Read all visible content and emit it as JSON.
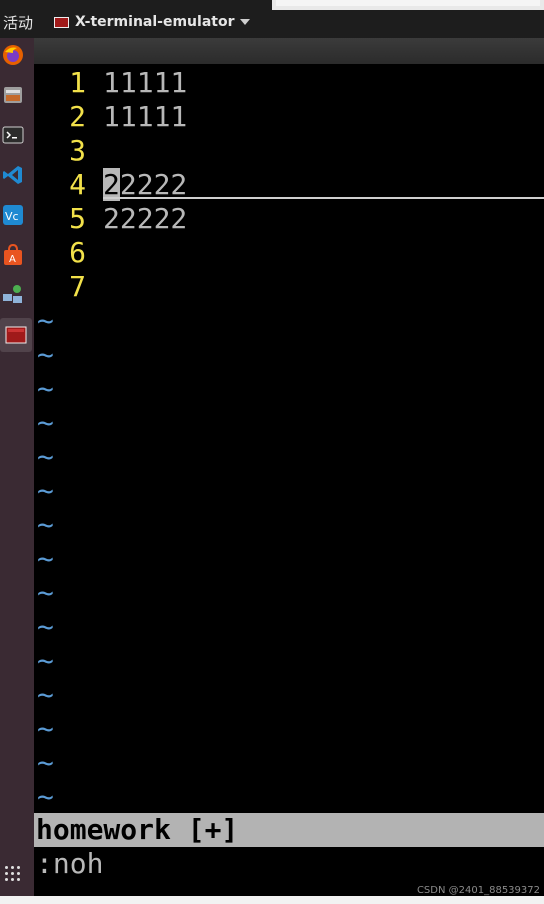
{
  "topbar": {
    "activities": "活动",
    "app_name": "X-terminal-emulator"
  },
  "dock": {
    "items": [
      {
        "name": "firefox-icon"
      },
      {
        "name": "files-icon"
      },
      {
        "name": "terminal-icon"
      },
      {
        "name": "vscode-icon"
      },
      {
        "name": "vnc-icon"
      },
      {
        "name": "software-center-icon"
      },
      {
        "name": "network-icon"
      },
      {
        "name": "x-terminal-icon"
      }
    ]
  },
  "editor": {
    "lines": [
      {
        "num": "1",
        "text": "11111"
      },
      {
        "num": "2",
        "text": "11111"
      },
      {
        "num": "3",
        "text": ""
      },
      {
        "num": "4",
        "cursor_char": "2",
        "text_rest": "2222"
      },
      {
        "num": "5",
        "text": "22222"
      },
      {
        "num": "6",
        "text": ""
      },
      {
        "num": "7",
        "text": ""
      }
    ],
    "tilde": "~",
    "tilde_count": 15
  },
  "statusline": {
    "text": "homework [+]"
  },
  "cmdline": {
    "text": ":noh"
  },
  "watermark": {
    "text": "CSDN @2401_88539372"
  },
  "colors": {
    "line_number": "#f2e14a",
    "text": "#b8b8b8",
    "tilde": "#5b9bd5",
    "statusline_bg": "#b3b3b3"
  }
}
